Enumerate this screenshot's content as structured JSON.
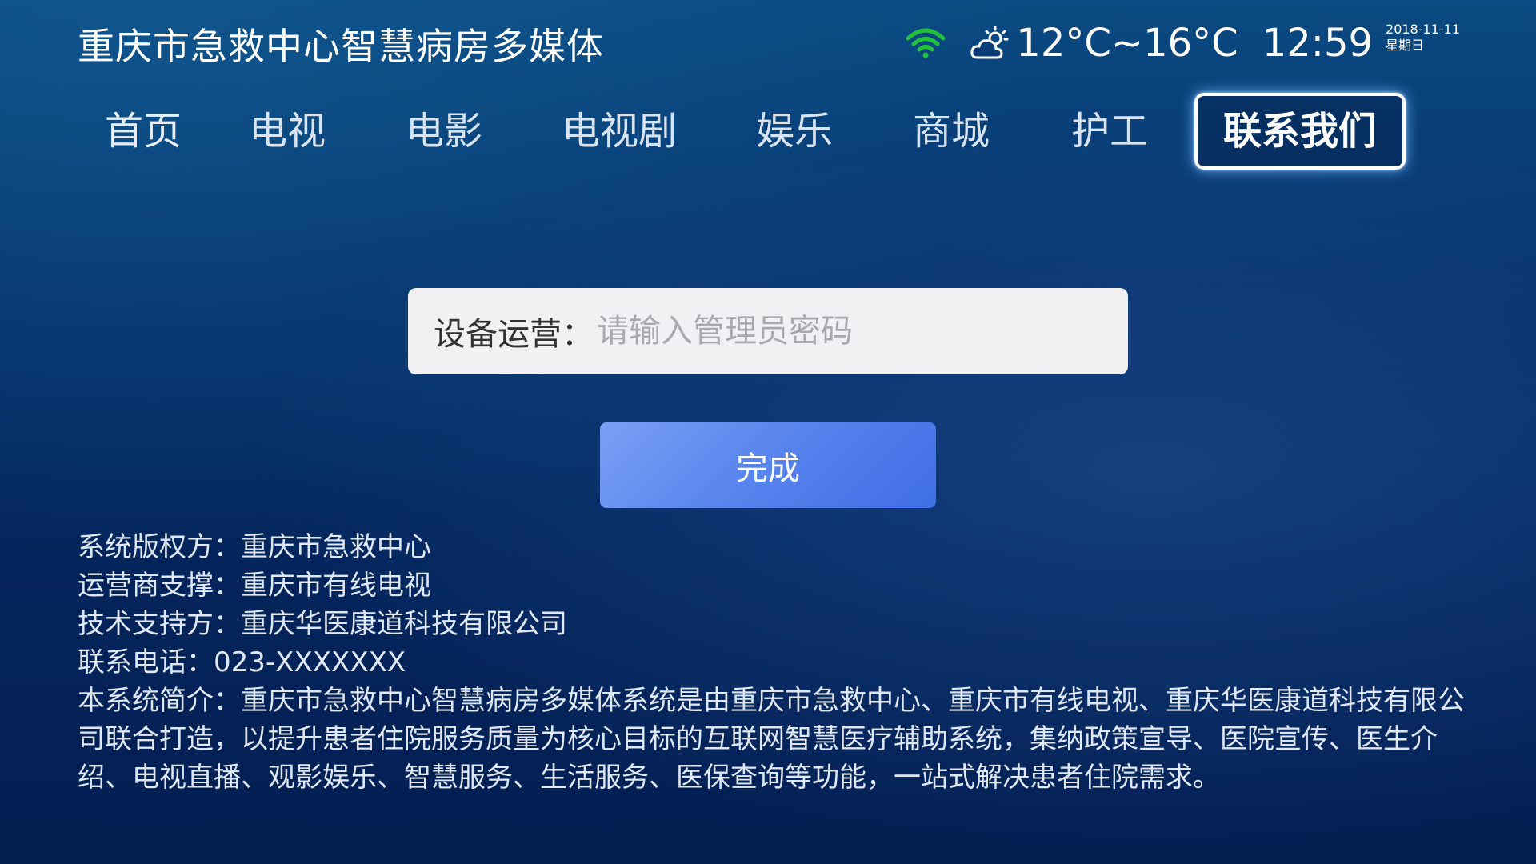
{
  "header": {
    "title": "重庆市急救中心智慧病房多媒体",
    "temperature": "12°C~16°C",
    "time": "12:59",
    "date": "2018-11-11",
    "weekday": "星期日",
    "wifi_color": "#22c03c"
  },
  "nav": {
    "items": [
      {
        "label": "首页"
      },
      {
        "label": "电视"
      },
      {
        "label": "电影"
      },
      {
        "label": "电视剧"
      },
      {
        "label": "娱乐"
      },
      {
        "label": "商城"
      },
      {
        "label": "护工"
      },
      {
        "label": "联系我们",
        "active": true
      }
    ]
  },
  "form": {
    "label": "设备运营：",
    "placeholder": "请输入管理员密码",
    "value": "",
    "done_label": "完成"
  },
  "info": {
    "copyright": "系统版权方：重庆市急救中心",
    "operator": "运营商支撑：重庆市有线电视",
    "tech_support": "技术支持方：重庆华医康道科技有限公司",
    "phone": "联系电话：023-XXXXXXX",
    "intro": "本系统简介：重庆市急救中心智慧病房多媒体系统是由重庆市急救中心、重庆市有线电视、重庆华医康道科技有限公司联合打造，以提升患者住院服务质量为核心目标的互联网智慧医疗辅助系统，集纳政策宣导、医院宣传、医生介绍、电视直播、观影娱乐、智慧服务、生活服务、医保查询等功能，一站式解决患者住院需求。"
  }
}
